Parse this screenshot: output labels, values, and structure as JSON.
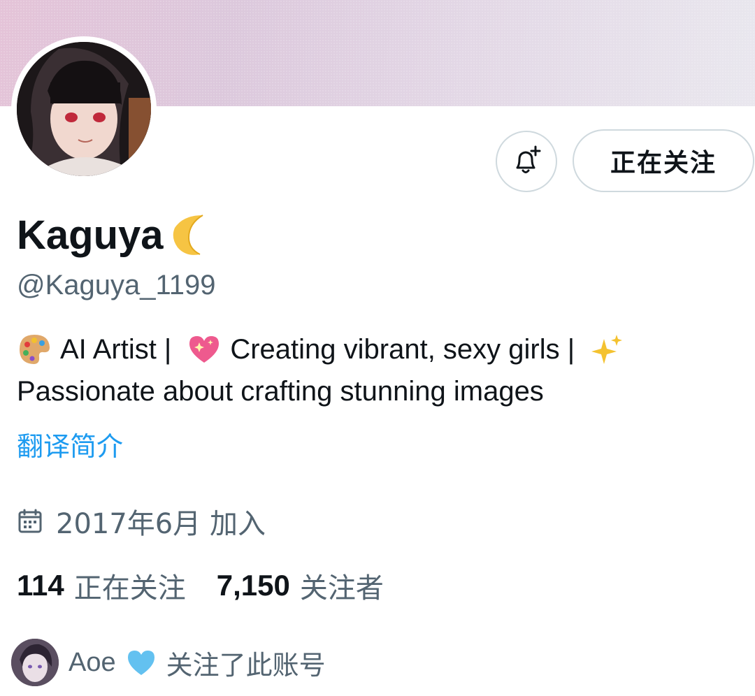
{
  "profile": {
    "display_name": "Kaguya",
    "name_emoji": "crescent-moon-icon",
    "handle": "@Kaguya_1199",
    "bio": {
      "seg1": "AI Artist |",
      "seg2": "Creating vibrant, sexy girls |",
      "line2": "Passionate about crafting stunning images"
    },
    "translate_bio": "翻译简介",
    "joined": "2017年6月 加入"
  },
  "actions": {
    "notify_icon": "bell-plus-icon",
    "following_label": "正在关注"
  },
  "stats": {
    "following_count": "114",
    "following_label": "正在关注",
    "followers_count": "7,150",
    "followers_label": "关注者"
  },
  "followed_by": {
    "name": "Aoe",
    "text": "关注了此账号"
  },
  "colors": {
    "accent_link": "#1d9bf0",
    "secondary_text": "#536471",
    "border": "#cfd9de"
  }
}
